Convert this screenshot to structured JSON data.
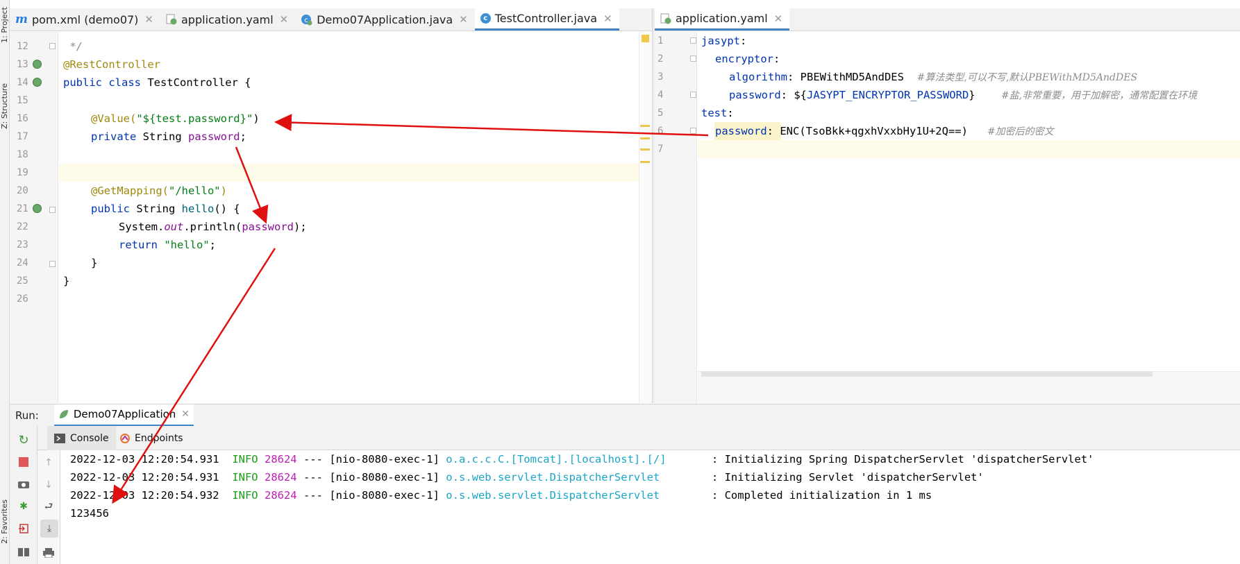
{
  "left_strip": {
    "project_label": "1: Project",
    "structure_label": "Z: Structure",
    "favorites_label": "2: Favorites"
  },
  "left_tabs": [
    {
      "label": "pom.xml (demo07)",
      "icon": "maven-icon"
    },
    {
      "label": "application.yaml",
      "icon": "spring-yaml-icon"
    },
    {
      "label": "Demo07Application.java",
      "icon": "spring-class-icon"
    },
    {
      "label": "TestController.java",
      "icon": "class-icon",
      "active": true
    }
  ],
  "right_tabs": [
    {
      "label": "application.yaml",
      "icon": "spring-yaml-icon",
      "active": true
    }
  ],
  "java_editor": {
    "line_numbers": [
      "12",
      "13",
      "14",
      "15",
      "16",
      "17",
      "18",
      "19",
      "20",
      "21",
      "22",
      "23",
      "24",
      "25",
      "26"
    ],
    "lines": {
      "l12": " */",
      "l13": "@RestController",
      "l14_kw": "public class ",
      "l14_name": "TestController {",
      "l16_ann": "@Value(",
      "l16_str": "\"${test.password}\"",
      "l16_end": ")",
      "l17_kw": "private ",
      "l17_type": "String ",
      "l17_fld": "password",
      "l17_end": ";",
      "l20_ann": "@GetMapping(",
      "l20_str": "\"/hello\"",
      "l20_end": ")",
      "l21_kw": "public ",
      "l21_type": "String ",
      "l21_mth": "hello",
      "l21_end": "() {",
      "l22_a": "System.",
      "l22_out": "out",
      "l22_b": ".println(",
      "l22_fld": "password",
      "l22_end": ");",
      "l23_kw": "return ",
      "l23_str": "\"hello\"",
      "l23_end": ";",
      "l24": "}",
      "l25": "}"
    }
  },
  "yaml_editor": {
    "line_numbers": [
      "1",
      "2",
      "3",
      "4",
      "5",
      "6",
      "7"
    ],
    "lines": {
      "y1_key": "jasypt",
      "y1_colon": ":",
      "y2_key": "encryptor",
      "y2_colon": ":",
      "y3_key": "algorithm",
      "y3_val": ": PBEWithMD5AndDES  ",
      "y3_cmt": "#算法类型,可以不写,默认PBEWithMD5AndDES",
      "y4_key": "password",
      "y4_val_a": ": ${",
      "y4_var": "JASYPT_ENCRYPTOR_PASSWORD",
      "y4_val_b": "}    ",
      "y4_cmt": "#盐,非常重要，用于加解密，通常配置在环境",
      "y5_key": "test",
      "y5_colon": ":",
      "y6_key": "password",
      "y6_val": ": ENC(TsoBkk+qgxhVxxbHy1U+2Q==)   ",
      "y6_cmt": "#加密后的密文"
    }
  },
  "run_panel": {
    "run_label": "Run:",
    "config_name": "Demo07Application",
    "console_tab": "Console",
    "endpoints_tab": "Endpoints",
    "log_lines": [
      {
        "ts": "2022-12-03 12:20:54.931",
        "level": "INFO",
        "pid": "28624",
        "sep": " --- [nio-8080-exec-1] ",
        "logger": "o.a.c.c.C.[Tomcat].[localhost].[/]      ",
        "msg": " : Initializing Spring DispatcherServlet 'dispatcherServlet'"
      },
      {
        "ts": "2022-12-03 12:20:54.931",
        "level": "INFO",
        "pid": "28624",
        "sep": " --- [nio-8080-exec-1] ",
        "logger": "o.s.web.servlet.DispatcherServlet       ",
        "msg": " : Initializing Servlet 'dispatcherServlet'"
      },
      {
        "ts": "2022-12-03 12:20:54.932",
        "level": "INFO",
        "pid": "28624",
        "sep": " --- [nio-8080-exec-1] ",
        "logger": "o.s.web.servlet.DispatcherServlet       ",
        "msg": " : Completed initialization in 1 ms"
      }
    ],
    "output_line": "123456"
  },
  "colors": {
    "annotation_arrow": "#e01010",
    "active_tab_underline": "#4083c9"
  }
}
